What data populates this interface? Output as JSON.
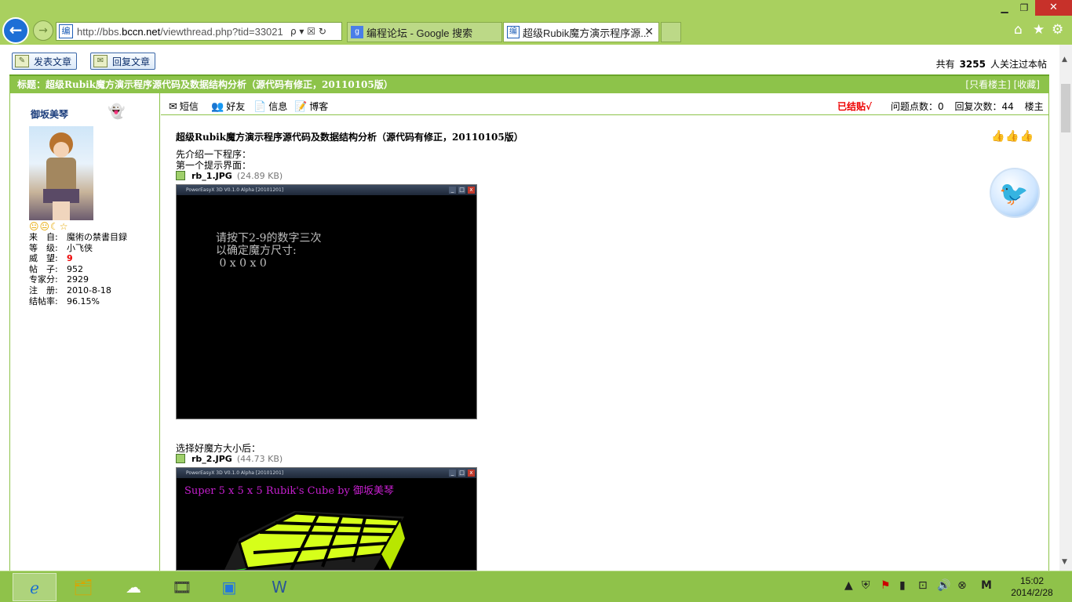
{
  "browser": {
    "url_prefix": "http://bbs.",
    "url_domain": "bccn.net",
    "url_suffix": "/viewthread.php?tid=33021",
    "address_controls": "ρ ▾ ☒ ↻",
    "tabs": [
      {
        "label": "编程论坛 - Google 搜索",
        "favicon": "g"
      },
      {
        "label": "超级Rubik魔方演示程序源...",
        "favicon": "编"
      }
    ],
    "favicon_text": "编"
  },
  "toolbar": {
    "post_button": "发表文章",
    "reply_button": "回复文章",
    "watch_prefix": "共有",
    "watch_count": "3255",
    "watch_suffix": "人关注过本帖"
  },
  "thread": {
    "title_label": "标题：超级Rubik魔方演示程序源代码及数据结构分析（源代码有修正，20110105版）",
    "only_op": "[只看楼主]",
    "favorite": "[收藏]"
  },
  "user": {
    "name": "御坂美琴",
    "emotes": "😐😐☾☆",
    "profile": [
      {
        "label": "来　自:",
        "value": "魔術の禁書目録"
      },
      {
        "label": "等　级:",
        "value": "小飞侠"
      },
      {
        "label": "威　望:",
        "value": "9",
        "highlight": true
      },
      {
        "label": "帖　子:",
        "value": "952"
      },
      {
        "label": "专家分:",
        "value": "2929"
      },
      {
        "label": "注　册:",
        "value": "2010-8-18"
      },
      {
        "label": "结帖率:",
        "value": "96.15%"
      }
    ]
  },
  "userbar": {
    "sms": "短信",
    "friend": "好友",
    "info": "信息",
    "blog": "博客",
    "solved": "已结贴√",
    "points": "问题点数：0",
    "replies": "回复次数：44",
    "floor": "楼主"
  },
  "post": {
    "title": "超级Rubik魔方演示程序源代码及数据结构分析（源代码有修正，20110105版）",
    "line1": "先介绍一下程序：",
    "line2": "第一个提示界面：",
    "attach1_name": "rb_1.JPG",
    "attach1_size": "(24.89 KB)",
    "shot1_window_title": "PowerEasyX 3D V0.1.0 Alpha [20101201]",
    "shot1_text": "请按下2-9的数字三次\n以确定魔方尺寸:\n 0 x 0 x 0",
    "line3": "选择好魔方大小后：",
    "attach2_name": "rb_2.JPG",
    "attach2_size": "(44.73 KB)",
    "shot2_window_title": "PowerEasyX 3D V0.1.0 Alpha [20101201]",
    "shot2_text": "Super 5 x 5 x 5 Rubik's Cube by 御坂美琴"
  },
  "taskbar": {
    "time": "15:02",
    "date": "2014/2/28"
  },
  "colors": {
    "chrome": "#a9d05f",
    "accent_green": "#8dc34a",
    "solved_red": "#e00000",
    "rubik_title": "#c71fd0"
  }
}
